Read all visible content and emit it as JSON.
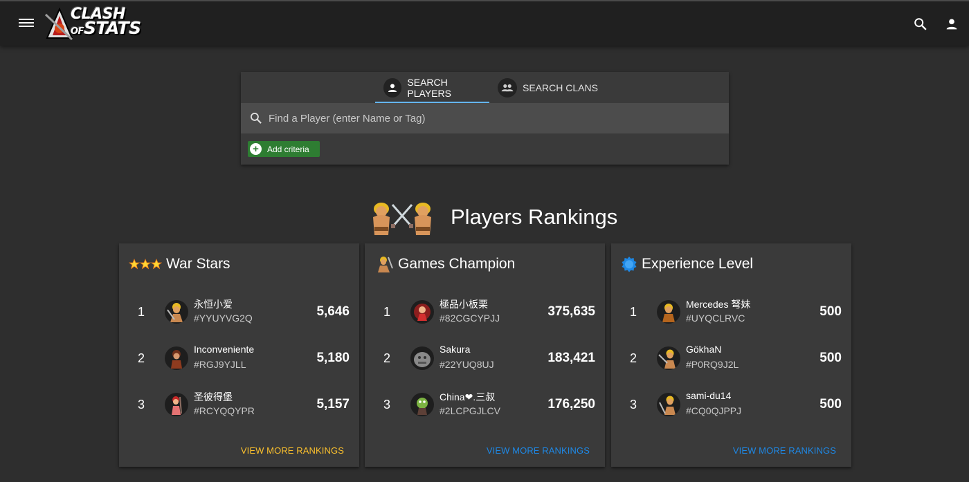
{
  "header": {
    "logo_line1": "CLASH",
    "logo_of": "OF",
    "logo_line2": "STATS",
    "menu_icon": "menu-icon",
    "search_icon": "search-icon",
    "account_icon": "account-icon"
  },
  "search": {
    "tabs": [
      {
        "label": "SEARCH PLAYERS",
        "icon": "person-icon",
        "active": true
      },
      {
        "label": "SEARCH CLANS",
        "icon": "group-icon",
        "active": false
      }
    ],
    "placeholder": "Find a Player (enter Name or Tag)",
    "add_criteria_label": "Add criteria"
  },
  "rankings": {
    "title": "Players Rankings",
    "cards": [
      {
        "title": "War Stars",
        "icon": "three-stars-icon",
        "rows": [
          {
            "rank": "1",
            "name": "永恒小爱",
            "tag": "#YYUYVG2Q",
            "value": "5,646"
          },
          {
            "rank": "2",
            "name": "Inconveniente",
            "tag": "#RGJ9YJLL",
            "value": "5,180"
          },
          {
            "rank": "3",
            "name": "圣彼得堡",
            "tag": "#RCYQQYPR",
            "value": "5,157"
          }
        ],
        "view_more": "VIEW MORE RANKINGS",
        "view_more_color": "#fbc02d"
      },
      {
        "title": "Games Champion",
        "icon": "barbarian-icon",
        "rows": [
          {
            "rank": "1",
            "name": "極品小板栗",
            "tag": "#82CGCYPJJ",
            "value": "375,635"
          },
          {
            "rank": "2",
            "name": "Sakura",
            "tag": "#22YUQ8UJ",
            "value": "183,421"
          },
          {
            "rank": "3",
            "name": "China❤.三叔",
            "tag": "#2LCPGJLCV",
            "value": "176,250"
          }
        ],
        "view_more": "VIEW MORE RANKINGS",
        "view_more_color": "#1e88e5"
      },
      {
        "title": "Experience Level",
        "icon": "xp-badge-icon",
        "rows": [
          {
            "rank": "1",
            "name": "Mercedes 弩妹",
            "tag": "#UYQCLRVC",
            "value": "500"
          },
          {
            "rank": "2",
            "name": "GökhaN",
            "tag": "#P0RQ9J2L",
            "value": "500"
          },
          {
            "rank": "3",
            "name": "sami-du14",
            "tag": "#CQ0QJPPJ",
            "value": "500"
          }
        ],
        "view_more": "VIEW MORE RANKINGS",
        "view_more_color": "#1e88e5"
      }
    ]
  }
}
